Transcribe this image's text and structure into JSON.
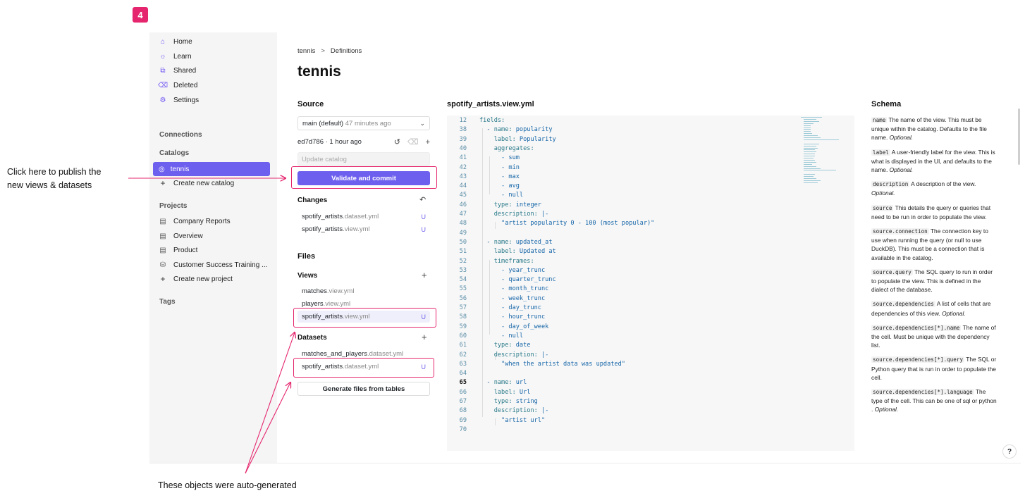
{
  "step_badge": "4",
  "sidebar": {
    "nav": [
      {
        "label": "Home",
        "icon": "home-icon",
        "glyph": "⌂"
      },
      {
        "label": "Learn",
        "icon": "lightbulb-icon",
        "glyph": "☼"
      },
      {
        "label": "Shared",
        "icon": "shared-icon",
        "glyph": "⧉"
      },
      {
        "label": "Deleted",
        "icon": "trash-icon",
        "glyph": "⌫"
      },
      {
        "label": "Settings",
        "icon": "gear-icon",
        "glyph": "⚙"
      }
    ],
    "connections_title": "Connections",
    "catalogs_title": "Catalogs",
    "active_catalog": "tennis",
    "create_catalog": "Create new catalog",
    "projects_title": "Projects",
    "projects": [
      "Company Reports",
      "Overview",
      "Product",
      "Customer Success Training ..."
    ],
    "create_project": "Create new project",
    "tags_title": "Tags"
  },
  "breadcrumb": {
    "root": "tennis",
    "separator": ">",
    "current": "Definitions"
  },
  "page_title": "tennis",
  "source": {
    "title": "Source",
    "branch": "main (default)",
    "branch_time": "47 minutes ago",
    "commit_id": "ed7d786 · 1 hour ago",
    "update_placeholder": "Update catalog",
    "validate_button": "Validate and commit",
    "changes_title": "Changes",
    "changes": [
      {
        "name": "spotify_artists",
        "ext": ".dataset.yml",
        "status": "U"
      },
      {
        "name": "spotify_artists",
        "ext": ".view.yml",
        "status": "U"
      }
    ]
  },
  "files": {
    "title": "Files",
    "views_title": "Views",
    "views": [
      {
        "name": "matches",
        "ext": ".view.yml",
        "status": ""
      },
      {
        "name": "players",
        "ext": ".view.yml",
        "status": ""
      },
      {
        "name": "spotify_artists",
        "ext": ".view.yml",
        "status": "U"
      }
    ],
    "datasets_title": "Datasets",
    "datasets": [
      {
        "name": "matches_and_players",
        "ext": ".dataset.yml",
        "status": ""
      },
      {
        "name": "spotify_artists",
        "ext": ".dataset.yml",
        "status": "U"
      }
    ],
    "generate_button": "Generate files from tables"
  },
  "editor": {
    "filename": "spotify_artists.view.yml",
    "lines": [
      {
        "n": "12",
        "t": "fields:"
      },
      {
        "n": "38",
        "t": "  - name: popularity"
      },
      {
        "n": "39",
        "t": "    label: Popularity"
      },
      {
        "n": "40",
        "t": "    aggregates:"
      },
      {
        "n": "41",
        "t": "      - sum"
      },
      {
        "n": "42",
        "t": "      - min"
      },
      {
        "n": "43",
        "t": "      - max"
      },
      {
        "n": "44",
        "t": "      - avg"
      },
      {
        "n": "45",
        "t": "      - null"
      },
      {
        "n": "46",
        "t": "    type: integer"
      },
      {
        "n": "47",
        "t": "    description: |-"
      },
      {
        "n": "48",
        "t": "      \"artist popularity 0 - 100 (most popular)\""
      },
      {
        "n": "49",
        "t": ""
      },
      {
        "n": "50",
        "t": "  - name: updated_at"
      },
      {
        "n": "51",
        "t": "    label: Updated at"
      },
      {
        "n": "52",
        "t": "    timeframes:"
      },
      {
        "n": "53",
        "t": "      - year_trunc"
      },
      {
        "n": "54",
        "t": "      - quarter_trunc"
      },
      {
        "n": "55",
        "t": "      - month_trunc"
      },
      {
        "n": "56",
        "t": "      - week_trunc"
      },
      {
        "n": "57",
        "t": "      - day_trunc"
      },
      {
        "n": "58",
        "t": "      - hour_trunc"
      },
      {
        "n": "59",
        "t": "      - day_of_week"
      },
      {
        "n": "60",
        "t": "      - null"
      },
      {
        "n": "61",
        "t": "    type: date"
      },
      {
        "n": "62",
        "t": "    description: |-"
      },
      {
        "n": "63",
        "t": "      \"when the artist data was updated\""
      },
      {
        "n": "64",
        "t": ""
      },
      {
        "n": "65",
        "t": "  - name: url"
      },
      {
        "n": "66",
        "t": "    label: Url"
      },
      {
        "n": "67",
        "t": "    type: string"
      },
      {
        "n": "68",
        "t": "    description: |-"
      },
      {
        "n": "69",
        "t": "      \"artist url\""
      },
      {
        "n": "70",
        "t": ""
      }
    ]
  },
  "schema": {
    "title": "Schema",
    "entries": [
      {
        "key": "name",
        "text": "The name of the view. This must be unique within the catalog. Defaults to the file name.",
        "optional": "Optional."
      },
      {
        "key": "label",
        "text": "A user-friendly label for the view. This is what is displayed in the UI, and defaults to the name.",
        "optional": "Optional."
      },
      {
        "key": "description",
        "text": "A description of the view.",
        "optional": "Optional."
      },
      {
        "key": "source",
        "text": "This details the query or queries that need to be run in order to populate the view.",
        "optional": ""
      },
      {
        "key": "source.connection",
        "text": "The connection key to use when running the query (or null to use DuckDB). This must be a connection that is available in the catalog.",
        "optional": ""
      },
      {
        "key": "source.query",
        "text": "The SQL query to run in order to populate the view. This is defined in the dialect of the database.",
        "optional": ""
      },
      {
        "key": "source.dependencies",
        "text": "A list of cells that are dependencies of this view.",
        "optional": "Optional."
      },
      {
        "key": "source.dependencies[*].name",
        "text": "The name of the cell. Must be unique with the dependency list.",
        "optional": ""
      },
      {
        "key": "source.dependencies[*].query",
        "text": "The SQL or Python query that is run in order to populate the cell.",
        "optional": ""
      },
      {
        "key": "source.dependencies[*].language",
        "text": "The type of the cell. This can be one of sql or python .",
        "optional": "Optional."
      }
    ]
  },
  "help_button": "?",
  "annotations": {
    "publish": [
      "Click here to publish the",
      "new views & datasets"
    ],
    "auto_generated": "These objects were auto-generated"
  },
  "colors": {
    "accent": "#6e60ee",
    "annotation": "#e5266e",
    "sidebar_bg": "#f5f5f5"
  }
}
